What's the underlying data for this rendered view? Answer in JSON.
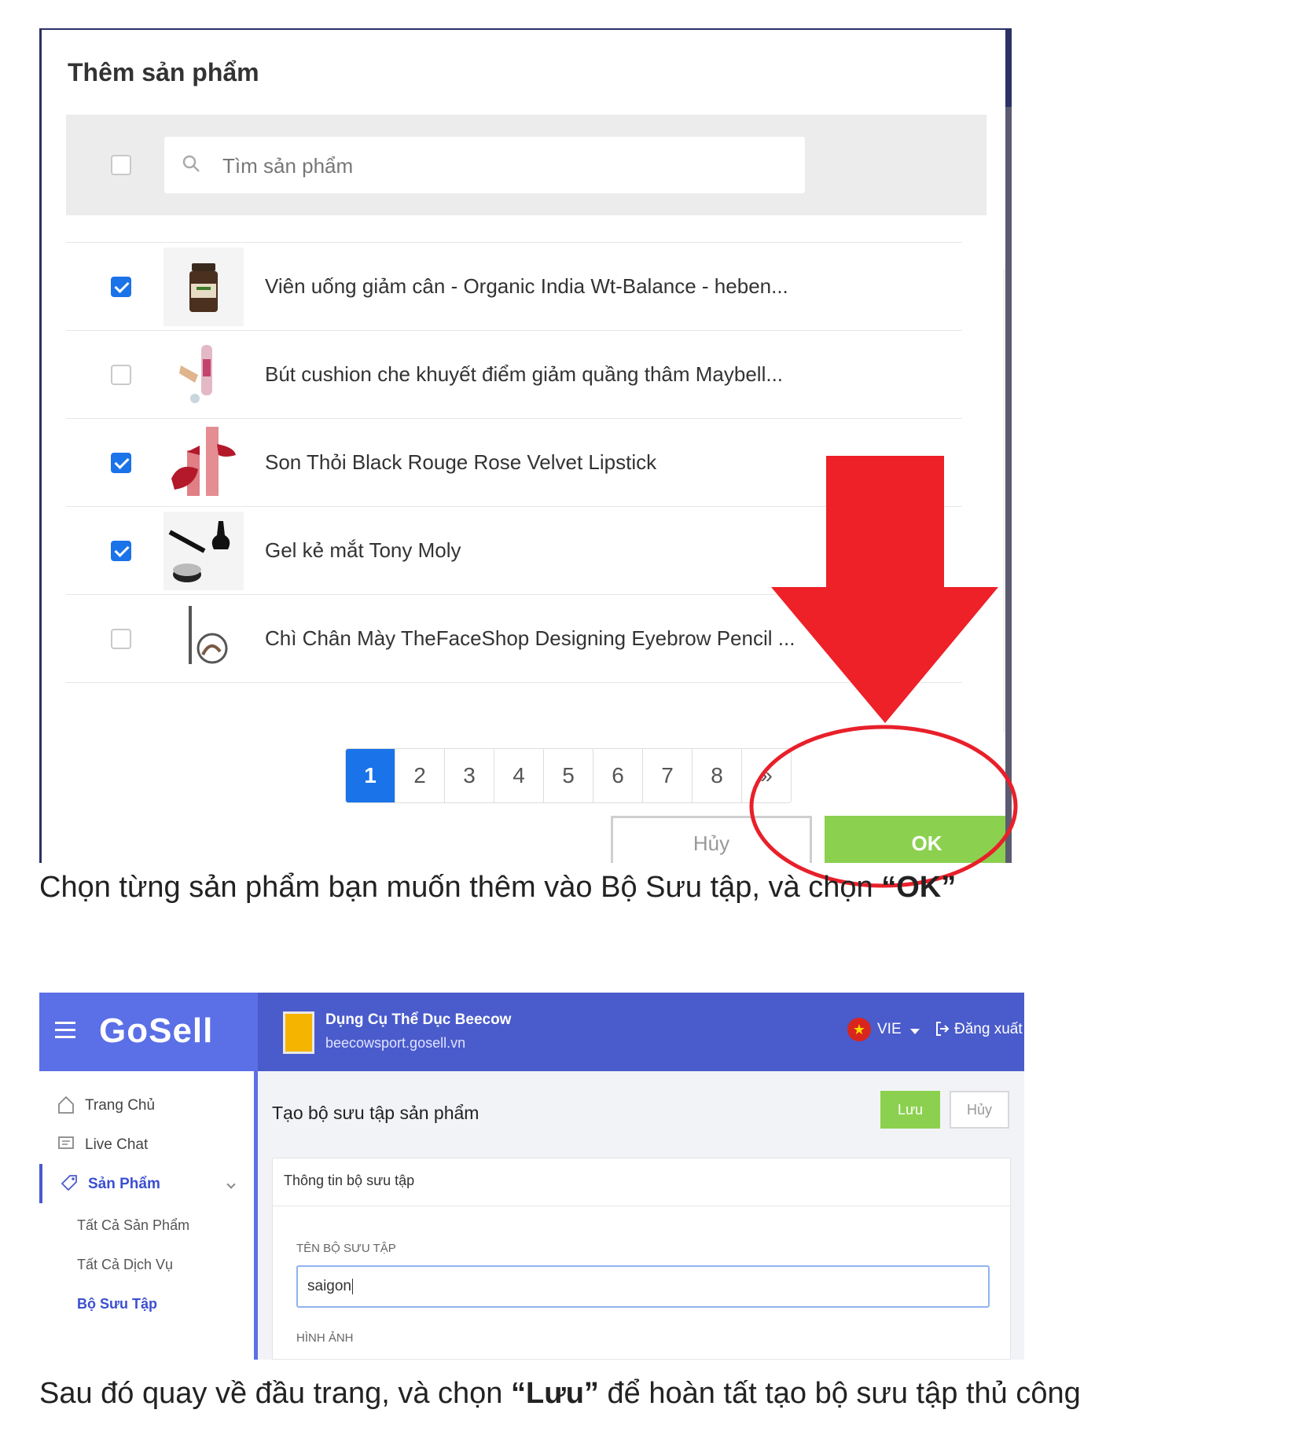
{
  "dialog": {
    "title": "Thêm sản phẩm",
    "search_placeholder": "Tìm sản phẩm",
    "select_all_checked": false,
    "products": [
      {
        "name": "Viên uống giảm cân - Organic India Wt-Balance - heben...",
        "checked": true,
        "thumb": "supplement-bottle"
      },
      {
        "name": "Bút cushion che khuyết điểm giảm quầng thâm Maybell...",
        "checked": false,
        "thumb": "concealer-pen"
      },
      {
        "name": "Son Thỏi Black Rouge Rose Velvet Lipstick",
        "checked": true,
        "thumb": "lipstick"
      },
      {
        "name": "Gel kẻ mắt Tony Moly",
        "checked": true,
        "thumb": "eyeliner-gel"
      },
      {
        "name": "Chì Chân Mày TheFaceShop Designing Eyebrow Pencil ...",
        "checked": false,
        "thumb": "eyebrow-pencil"
      }
    ],
    "pagination": {
      "pages": [
        "1",
        "2",
        "3",
        "4",
        "5",
        "6",
        "7",
        "8",
        "»"
      ],
      "active": "1"
    },
    "cancel_label": "Hủy",
    "ok_label": "OK"
  },
  "caption1": {
    "text": "Chọn từng sản phẩm bạn muốn thêm vào Bộ Sưu tập, và chọn ",
    "bold": "“OK”"
  },
  "admin": {
    "logo": "GoSell",
    "store_name": "Dụng Cụ Thể Dục Beecow",
    "store_url": "beecowsport.gosell.vn",
    "language": "VIE",
    "logout_label": "Đăng xuất",
    "sidebar": {
      "items": [
        {
          "label": "Trang Chủ",
          "icon": "home-icon"
        },
        {
          "label": "Live Chat",
          "icon": "chat-icon"
        },
        {
          "label": "Sản Phẩm",
          "icon": "tag-icon",
          "active": true
        }
      ],
      "subitems": [
        {
          "label": "Tất Cả Sản Phẩm"
        },
        {
          "label": "Tất Cả Dịch Vụ"
        },
        {
          "label": "Bộ Sưu Tập",
          "active": true
        }
      ]
    },
    "page_title": "Tạo bộ sưu tập sản phẩm",
    "save_label": "Lưu",
    "cancel_label": "Hủy",
    "card_title": "Thông tin bộ sưu tập",
    "name_label": "TÊN BỘ SƯU TẬP",
    "name_value": "saigon",
    "image_label": "HÌNH ẢNH"
  },
  "caption2": {
    "text_before": "Sau đó quay về đầu trang, và chọn ",
    "bold": "“Lưu”",
    "text_after": " để hoàn tất tạo bộ sưu tập thủ công"
  },
  "colors": {
    "accent_blue": "#1a73e8",
    "ok_green": "#8bd14f",
    "annotation_red": "#e8202a",
    "gosell_blue": "#4a5bcb"
  }
}
